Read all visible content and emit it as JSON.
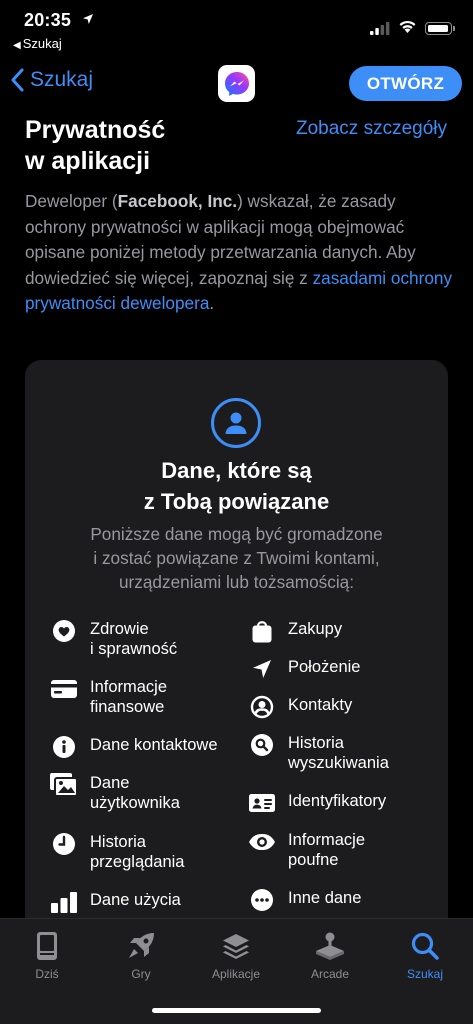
{
  "status": {
    "time": "20:35",
    "back_app": "Szukaj"
  },
  "nav": {
    "back_label": "Szukaj",
    "open_label": "OTWÓRZ"
  },
  "privacy": {
    "title_line1": "Prywatność",
    "title_line2": "w aplikacji",
    "see_details": "Zobacz szczegóły",
    "desc_prefix": "Deweloper (",
    "desc_company": "Facebook, Inc.",
    "desc_middle": ") wskazał, że zasady ochrony prywatności w aplikacji mogą obejmować opisane poniżej metody przetwarzania danych. Aby dowiedzieć się więcej, zapoznaj się z ",
    "desc_link": "zasadami ochrony prywatności dewelopera",
    "desc_suffix": "."
  },
  "card": {
    "title_line1": "Dane, które są",
    "title_line2": "z Tobą powiązane",
    "subtitle_line1": "Poniższe dane mogą być gromadzone",
    "subtitle_line2": "i zostać powiązane z Twoimi kontami,",
    "subtitle_line3": "urządzeniami lub tożsamością:",
    "left_items": [
      {
        "label": "Zdrowie\ni sprawność",
        "icon": "heart-icon"
      },
      {
        "label": "Informacje\nfinansowe",
        "icon": "credit-card-icon"
      },
      {
        "label": "Dane kontaktowe",
        "icon": "info-icon"
      },
      {
        "label": "Dane\nużytkownika",
        "icon": "photos-icon"
      },
      {
        "label": "Historia\nprzeglądania",
        "icon": "clock-icon"
      },
      {
        "label": "Dane użycia",
        "icon": "bar-chart-icon"
      }
    ],
    "right_items": [
      {
        "label": "Zakupy",
        "icon": "shopping-bag-icon"
      },
      {
        "label": "Położenie",
        "icon": "location-arrow-icon"
      },
      {
        "label": "Kontakty",
        "icon": "person-circle-icon"
      },
      {
        "label": "Historia\nwyszukiwania",
        "icon": "search-circle-icon"
      },
      {
        "label": "Identyfikatory",
        "icon": "id-card-icon"
      },
      {
        "label": "Informacje\npoufne",
        "icon": "eye-icon"
      },
      {
        "label": "Inne dane",
        "icon": "more-circle-icon"
      }
    ]
  },
  "tabs": [
    {
      "label": "Dziś",
      "icon": "today-icon"
    },
    {
      "label": "Gry",
      "icon": "rocket-icon"
    },
    {
      "label": "Aplikacje",
      "icon": "layers-icon"
    },
    {
      "label": "Arcade",
      "icon": "joystick-icon"
    },
    {
      "label": "Szukaj",
      "icon": "search-icon"
    }
  ],
  "colors": {
    "accent": "#3e8ef7",
    "background": "#000000",
    "card": "#1c1c1e",
    "secondary_text": "#98989f"
  }
}
